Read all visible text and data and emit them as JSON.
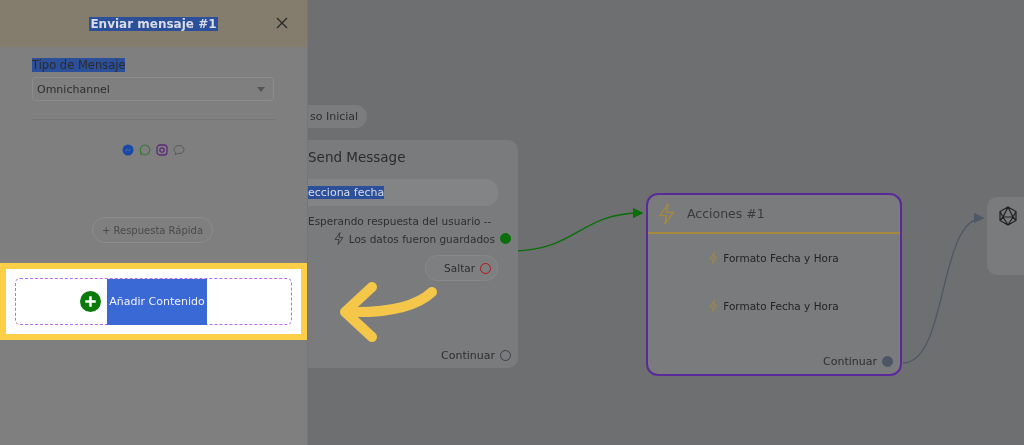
{
  "panel": {
    "title": {
      "text": "Enviar mensaje #1",
      "text_selected": true
    },
    "type_label": {
      "text": "Tipo de Mensaje",
      "text_selected": true
    },
    "type_select": {
      "value": "Omnichannel"
    },
    "quick_reply": {
      "label": "+ Respuesta Rápida",
      "disabled": true
    },
    "add_content": {
      "label": "Añadir Contenido",
      "text_selected": true
    }
  },
  "canvas": {
    "start_pill": "so Inicial",
    "nodes": [
      {
        "kind": "message",
        "title": "Send Message",
        "selected": false,
        "field": {
          "value": "ecciona fecha",
          "text_selected": true
        },
        "status": "Esperando respuesta del usuario --",
        "outputs": [
          {
            "label": "Los datos fueron guardados",
            "connected": true,
            "color": "#0a6e0a"
          },
          {
            "label": "Saltar",
            "connected": false,
            "color": "#b0161a"
          }
        ],
        "continue": {
          "label": "Continuar",
          "connected": false
        }
      },
      {
        "kind": "actions",
        "title": "Acciones #1",
        "selected": true,
        "actions": [
          "Formato Fecha y Hora",
          "Formato Fecha y Hora"
        ],
        "continue": {
          "label": "Continuar",
          "connected": true
        }
      },
      {
        "kind": "ai"
      }
    ]
  }
}
